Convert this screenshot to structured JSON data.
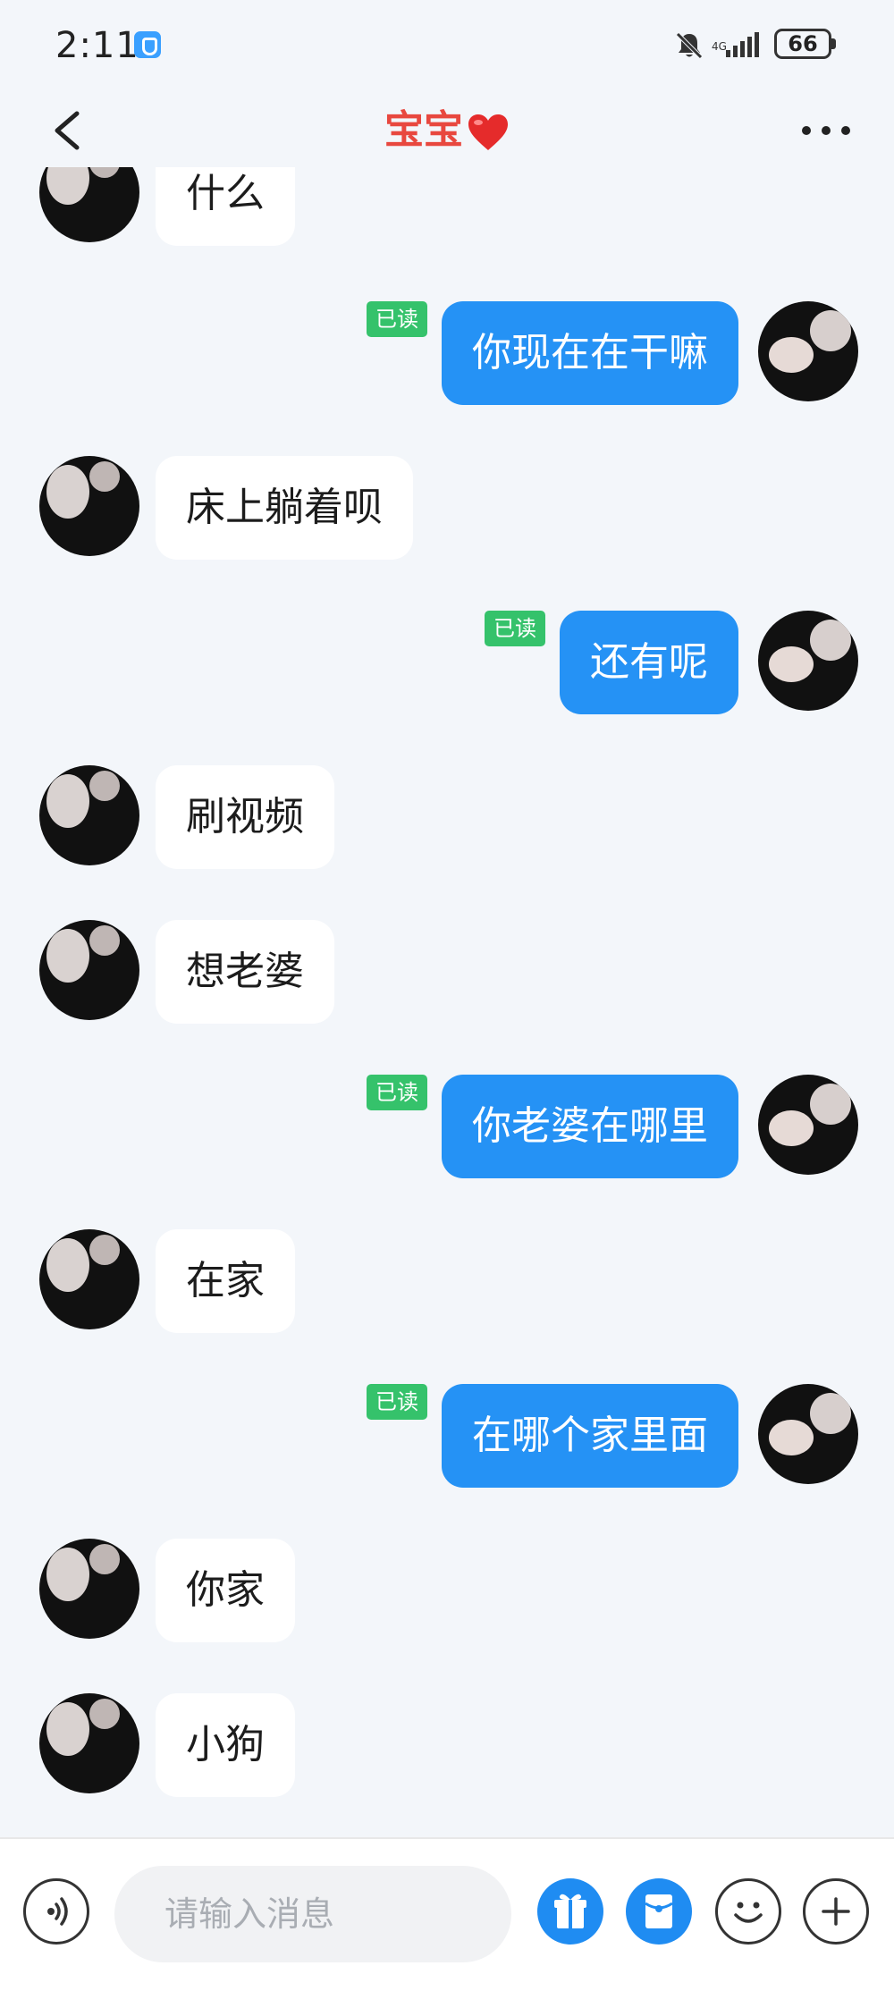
{
  "status_bar": {
    "time": "2:11",
    "battery": "66"
  },
  "header": {
    "title": "宝宝"
  },
  "read_label": "已读",
  "messages": [
    {
      "side": "in",
      "text": "什么"
    },
    {
      "side": "out",
      "text": "你现在在干嘛",
      "read": true
    },
    {
      "side": "in",
      "text": "床上躺着呗"
    },
    {
      "side": "out",
      "text": "还有呢",
      "read": true
    },
    {
      "side": "in",
      "text": "刷视频"
    },
    {
      "side": "in",
      "text": "想老婆"
    },
    {
      "side": "out",
      "text": "你老婆在哪里",
      "read": true
    },
    {
      "side": "in",
      "text": "在家"
    },
    {
      "side": "out",
      "text": "在哪个家里面",
      "read": true
    },
    {
      "side": "in",
      "text": "你家"
    },
    {
      "side": "in",
      "text": "小狗"
    }
  ],
  "composer": {
    "placeholder": "请输入消息"
  },
  "colors": {
    "sent_bubble": "#2592f5",
    "read_badge": "#35c26b",
    "title": "#e8483f"
  },
  "icons": [
    "back-icon",
    "heart-icon",
    "more-icon",
    "voice-icon",
    "gift-icon",
    "red-envelope-icon",
    "emoji-icon",
    "plus-icon",
    "mute-icon",
    "signal-icon"
  ]
}
